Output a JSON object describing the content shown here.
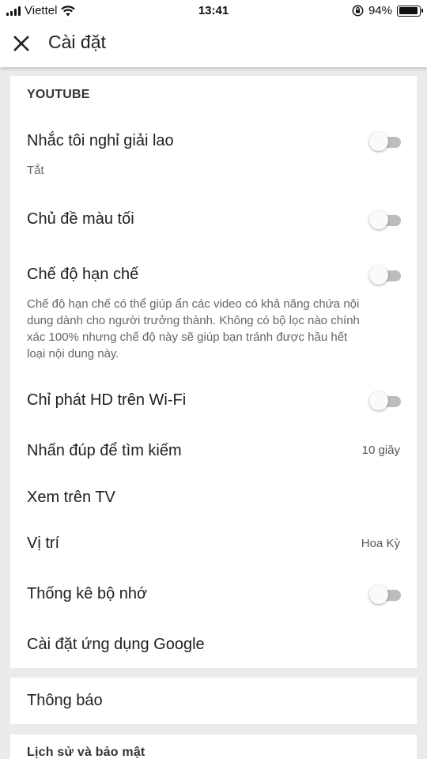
{
  "status_bar": {
    "carrier": "Viettel",
    "time": "13:41",
    "battery_percent": "94%",
    "battery_level": 0.94,
    "icons": [
      "signal-icon",
      "wifi-icon",
      "orientation-lock-icon",
      "battery-icon"
    ]
  },
  "app_bar": {
    "close_icon": "close-icon",
    "title": "Cài đặt"
  },
  "youtube_section": {
    "header": "YOUTUBE",
    "items": [
      {
        "label": "Nhắc tôi nghỉ giải lao",
        "subtitle": "Tắt",
        "control": "toggle",
        "on": false
      },
      {
        "label": "Chủ đề màu tối",
        "control": "toggle",
        "on": false
      },
      {
        "label": "Chế độ hạn chế",
        "description": "Chế độ hạn chế có thể giúp ẩn các video có khả năng chứa nội dung dành cho người trưởng thành. Không có bộ lọc nào chính xác 100% nhưng chế độ này sẽ giúp bạn tránh được hầu hết loại nội dung này.",
        "control": "toggle",
        "on": false
      },
      {
        "label": "Chỉ phát HD trên Wi-Fi",
        "control": "toggle",
        "on": false
      },
      {
        "label": "Nhấn đúp để tìm kiếm",
        "value": "10 giây"
      },
      {
        "label": "Xem trên TV"
      },
      {
        "label": "Vị trí",
        "value": "Hoa Kỳ"
      },
      {
        "label": "Thống kê bộ nhớ",
        "control": "toggle",
        "on": false
      },
      {
        "label": "Cài đặt ứng dụng Google"
      }
    ]
  },
  "notifications": {
    "label": "Thông báo"
  },
  "history_privacy": {
    "header": "Lịch sử và bảo mật"
  },
  "colors": {
    "background": "#ebebeb",
    "card": "#ffffff",
    "toggle_track_off": "#bdbdbd",
    "toggle_thumb_off": "#fafafa"
  }
}
